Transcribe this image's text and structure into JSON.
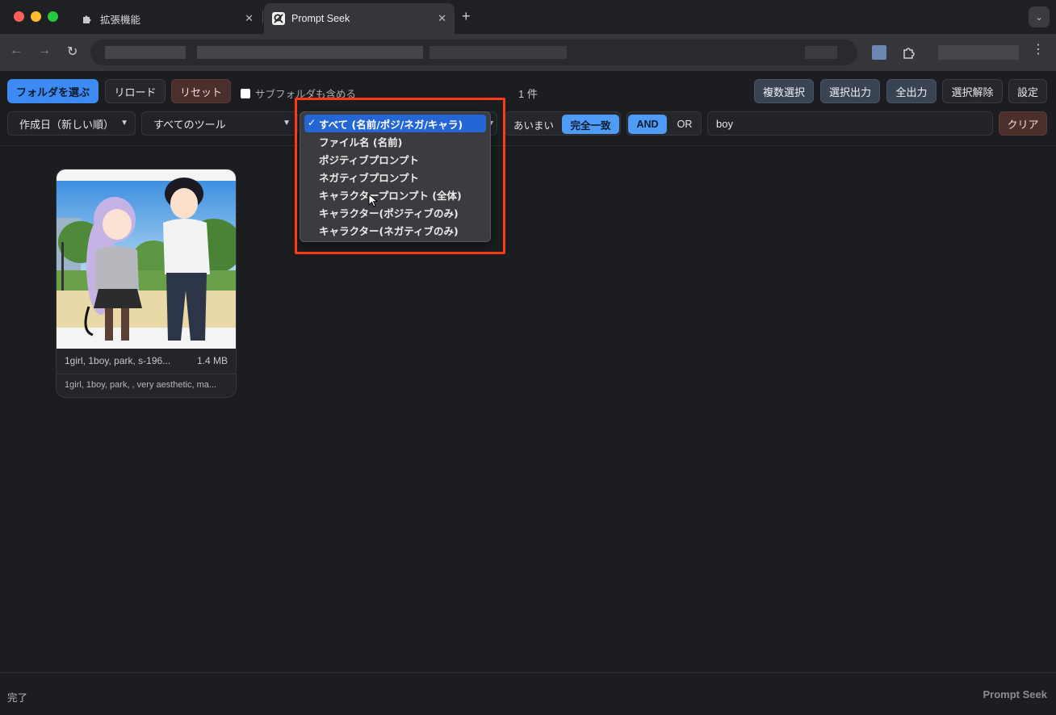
{
  "browser": {
    "tabs": [
      {
        "label": "拡張機能",
        "close": "✕"
      },
      {
        "label": "Prompt Seek",
        "close": "✕"
      }
    ],
    "new_tab": "+",
    "tab_menu": "⌄",
    "nav": {
      "back": "←",
      "forward": "→",
      "reload": "↻"
    },
    "menu": "⋮"
  },
  "toolbar": {
    "choose_folder": "フォルダを選ぶ",
    "reload": "リロード",
    "reset": "リセット",
    "include_subfolders": "サブフォルダも含める",
    "result_count": "1 件",
    "multi_select": "複数選択",
    "export_selected": "選択出力",
    "export_all": "全出力",
    "clear_selection": "選択解除",
    "settings": "設定"
  },
  "filters": {
    "sort": "作成日（新しい順）",
    "tool": "すべてのツール",
    "match_fuzzy": "あいまい",
    "match_exact": "完全一致",
    "logic_and": "AND",
    "logic_or": "OR",
    "search_value": "boy",
    "clear": "クリア"
  },
  "target_dropdown": {
    "options": [
      "すべて (名前/ポジ/ネガ/キャラ)",
      "ファイル名 (名前)",
      "ポジティブプロンプト",
      "ネガティブプロンプト",
      "キャラクタープロンプト (全体)",
      "キャラクター(ポジティブのみ)",
      "キャラクター(ネガティブのみ)"
    ],
    "checkmark": "✓"
  },
  "cards": [
    {
      "name": "1girl, 1boy, park, s-196...",
      "size": "1.4 MB",
      "prompt": "1girl, 1boy, park, , very aesthetic, ma..."
    }
  ],
  "status": {
    "left": "完了",
    "right": "Prompt Seek"
  },
  "colors": {
    "primary": "#3d8bf2",
    "highlight_box": "#ff3b17",
    "selected_option": "#2466d6"
  }
}
